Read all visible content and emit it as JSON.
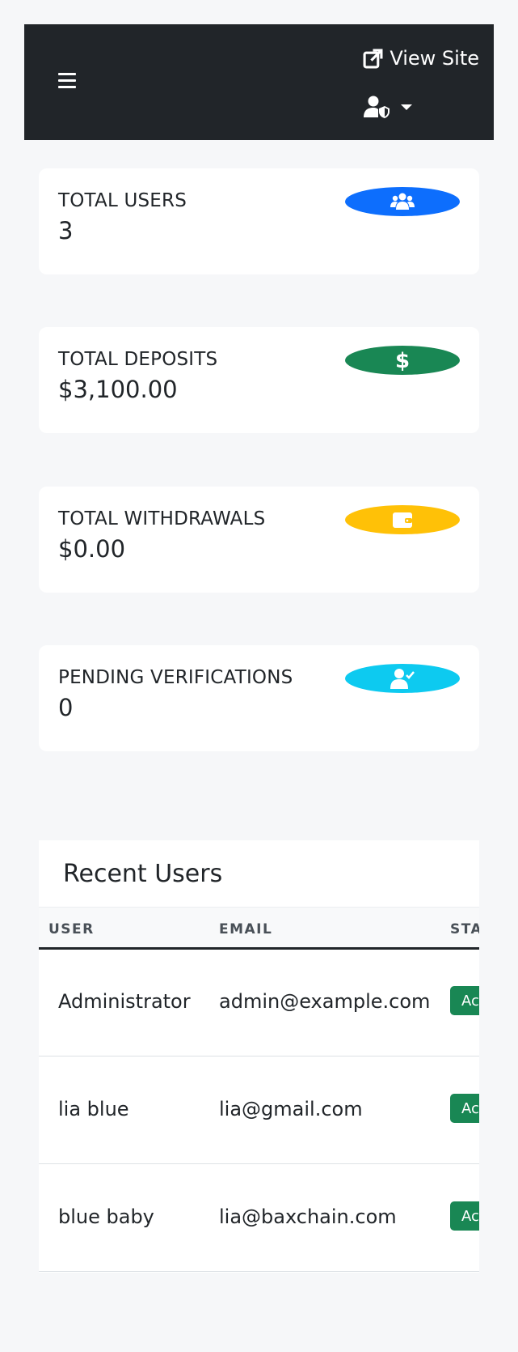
{
  "topbar": {
    "menu_icon": "hamburger-icon",
    "view_site_label": "View Site",
    "view_site_icon": "external-link-icon",
    "user_icon": "user-shield-icon"
  },
  "stats": [
    {
      "label": "TOTAL USERS",
      "value": "3",
      "icon": "users-icon",
      "color": "#0d6efd"
    },
    {
      "label": "TOTAL DEPOSITS",
      "value": "$3,100.00",
      "icon": "dollar-icon",
      "color": "#198754"
    },
    {
      "label": "TOTAL WITHDRAWALS",
      "value": "$0.00",
      "icon": "wallet-icon",
      "color": "#ffc107"
    },
    {
      "label": "PENDING VERIFICATIONS",
      "value": "0",
      "icon": "user-check-icon",
      "color": "#0dcaf0"
    }
  ],
  "recent_users": {
    "title": "Recent Users",
    "columns": [
      "USER",
      "EMAIL",
      "STATUS"
    ],
    "rows": [
      {
        "user": "Administrator",
        "email": "admin@example.com",
        "status": "Active"
      },
      {
        "user": "lia blue",
        "email": "lia@gmail.com",
        "status": "Active"
      },
      {
        "user": "blue baby",
        "email": "lia@baxchain.com",
        "status": "Active"
      }
    ]
  }
}
